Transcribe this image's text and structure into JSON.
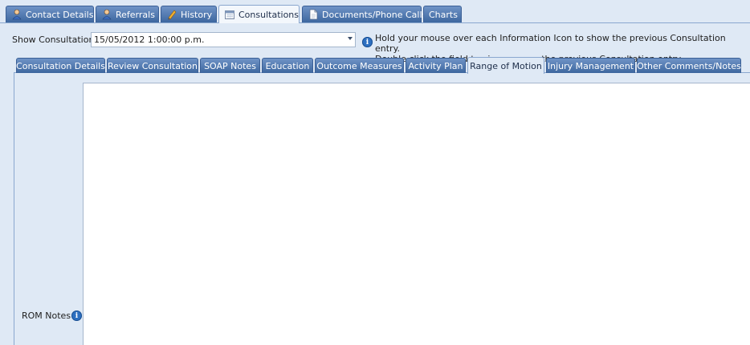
{
  "top_tabs": [
    {
      "label": "Contact Details",
      "icon": "person-icon",
      "active": false
    },
    {
      "label": "Referrals",
      "icon": "person-icon",
      "active": false
    },
    {
      "label": "History",
      "icon": "pencil-icon",
      "active": false
    },
    {
      "label": "Consultations",
      "icon": "calendar-icon",
      "active": true
    },
    {
      "label": "Documents/Phone Calls",
      "icon": "document-icon",
      "active": false
    },
    {
      "label": "Charts",
      "icon": "",
      "active": false
    }
  ],
  "consultation": {
    "label": "Show Consultation:",
    "selected": "15/05/2012 1:00:00 p.m."
  },
  "hint": {
    "line1": "Hold your mouse over each Information Icon to show the previous Consultation entry.",
    "line2": "Double click the field to view or copy the previous Consultation entry."
  },
  "inner_tabs": [
    {
      "label": "Consultation Details",
      "active": false
    },
    {
      "label": "Review Consultation",
      "active": false
    },
    {
      "label": "SOAP Notes",
      "active": false
    },
    {
      "label": "Education",
      "active": false
    },
    {
      "label": "Outcome Measures",
      "active": false
    },
    {
      "label": "Activity Plan",
      "active": false
    },
    {
      "label": "Range of Motion",
      "active": true
    },
    {
      "label": "Injury Management",
      "active": false
    },
    {
      "label": "Other Comments/Notes",
      "active": false
    }
  ],
  "rom": {
    "label": "ROM Notes",
    "value": ""
  },
  "colors": {
    "tab_blue": "#4f78b0",
    "background": "#dfe9f5",
    "info_blue": "#2d6fc0"
  }
}
